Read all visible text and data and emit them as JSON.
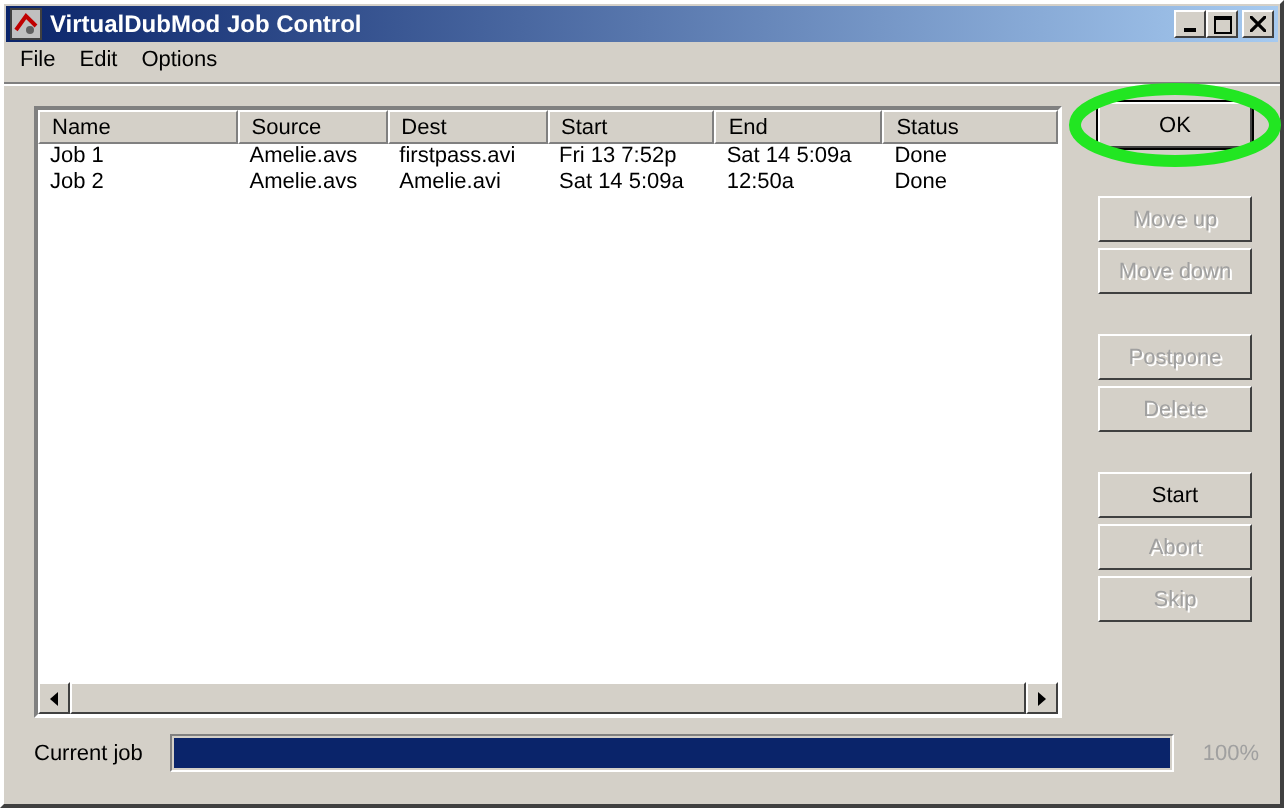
{
  "window": {
    "title": "VirtualDubMod Job Control"
  },
  "menu": [
    "File",
    "Edit",
    "Options"
  ],
  "table": {
    "columns": [
      "Name",
      "Source",
      "Dest",
      "Start",
      "End",
      "Status"
    ],
    "rows": [
      [
        "Job 1",
        "Amelie.avs",
        "firstpass.avi",
        "Fri 13 7:52p",
        "Sat 14 5:09a",
        "Done"
      ],
      [
        "Job 2",
        "Amelie.avs",
        "Amelie.avi",
        "Sat 14 5:09a",
        "12:50a",
        "Done"
      ]
    ]
  },
  "button_groups": [
    [
      {
        "label": "OK",
        "disabled": false,
        "highlighted": true
      }
    ],
    [
      {
        "label": "Move up",
        "disabled": true,
        "highlighted": false
      },
      {
        "label": "Move down",
        "disabled": true,
        "highlighted": false
      }
    ],
    [
      {
        "label": "Postpone",
        "disabled": true,
        "highlighted": false
      },
      {
        "label": "Delete",
        "disabled": true,
        "highlighted": false
      }
    ],
    [
      {
        "label": "Start",
        "disabled": false,
        "highlighted": false
      },
      {
        "label": "Abort",
        "disabled": true,
        "highlighted": false
      },
      {
        "label": "Skip",
        "disabled": true,
        "highlighted": false
      }
    ]
  ],
  "progress": {
    "label": "Current job",
    "level": 1,
    "reading": "100%"
  }
}
